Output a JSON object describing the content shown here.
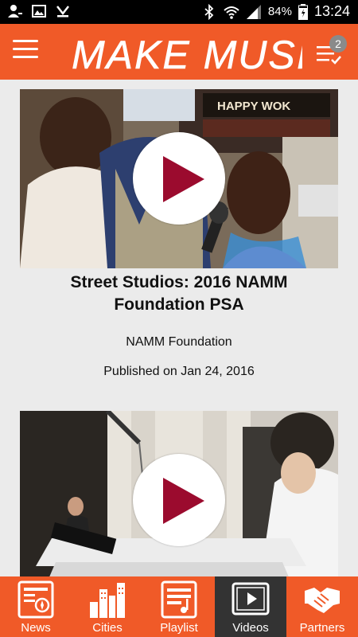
{
  "status_bar": {
    "battery_percent": "84%",
    "time": "13:24",
    "icons": [
      "contact-icon",
      "image-icon",
      "download-icon",
      "bluetooth-icon",
      "wifi-icon",
      "signal-icon",
      "battery-icon"
    ]
  },
  "app_bar": {
    "brand": "MAKE MUSIC",
    "playlist_badge": "2",
    "color": "#f05a28"
  },
  "videos": [
    {
      "title": "Street Studios: 2016 NAMM Foundation PSA",
      "channel": "NAMM Foundation",
      "published": "Published on Jan 24, 2016",
      "sign_text": "HAPPY WOK"
    },
    {
      "title": "",
      "channel": "",
      "published": ""
    }
  ],
  "bottom_nav": {
    "items": [
      {
        "label": "News",
        "icon": "news-icon"
      },
      {
        "label": "Cities",
        "icon": "cities-icon"
      },
      {
        "label": "Playlist",
        "icon": "playlist-icon"
      },
      {
        "label": "Videos",
        "icon": "videos-icon",
        "active": true
      },
      {
        "label": "Partners",
        "icon": "partners-icon"
      }
    ]
  },
  "colors": {
    "accent": "#f05a28",
    "play": "#9b0b2e",
    "active_nav": "#333333"
  }
}
